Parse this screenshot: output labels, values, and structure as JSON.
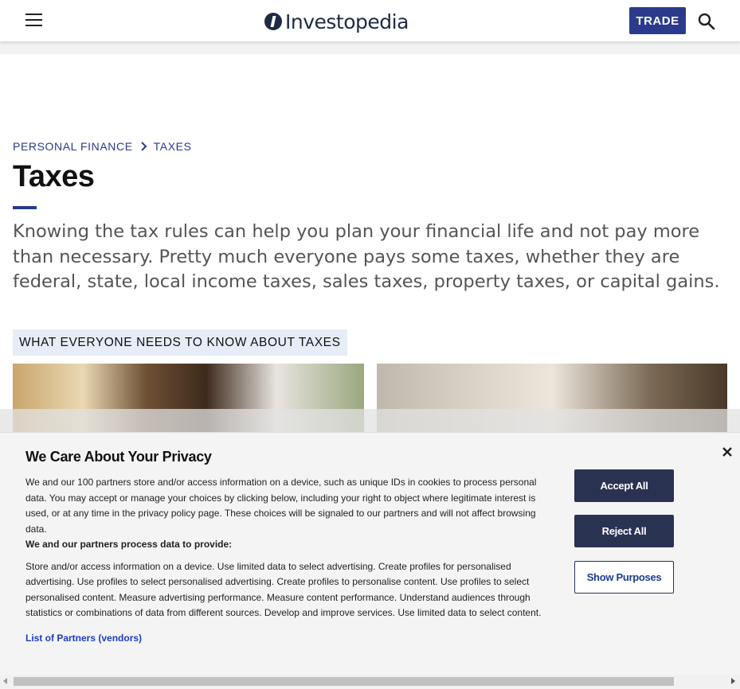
{
  "header": {
    "logo_text": "Investopedia",
    "trade_label": "TRADE",
    "accent": "#2b3a8c"
  },
  "breadcrumb": {
    "items": [
      "PERSONAL FINANCE",
      "TAXES"
    ]
  },
  "page": {
    "title": "Taxes",
    "intro": "Knowing the tax rules can help you plan your financial life and not pay more than necessary. Pretty much everyone pays some taxes, whether they are federal, state, local income taxes, sales taxes, property taxes, or capital gains.",
    "section_label": "WHAT EVERYONE NEEDS TO KNOW ABOUT TAXES"
  },
  "privacy": {
    "title": "We Care About Your Privacy",
    "body": "We and our 100 partners store and/or access information on a device, such as unique IDs in cookies to process personal data. You may accept or manage your choices by clicking below, including your right to object where legitimate interest is used, or at any time in the privacy policy page. These choices will be signaled to our partners and will not affect browsing data.",
    "subheading": "We and our partners process data to provide:",
    "purposes": "Store and/or access information on a device. Use limited data to select advertising. Create profiles for personalised advertising. Use profiles to select personalised advertising. Create profiles to personalise content. Use profiles to select personalised content. Measure advertising performance. Measure content performance. Understand audiences through statistics or combinations of data from different sources. Develop and improve services. Use limited data to select content.",
    "partners_link": "List of Partners (vendors)",
    "accept_label": "Accept All",
    "reject_label": "Reject All",
    "show_purposes_label": "Show Purposes"
  },
  "icons": {
    "menu": "hamburger-menu-icon",
    "search": "search-icon",
    "close": "close-icon",
    "breadcrumb_separator": "chevron-right-icon"
  }
}
